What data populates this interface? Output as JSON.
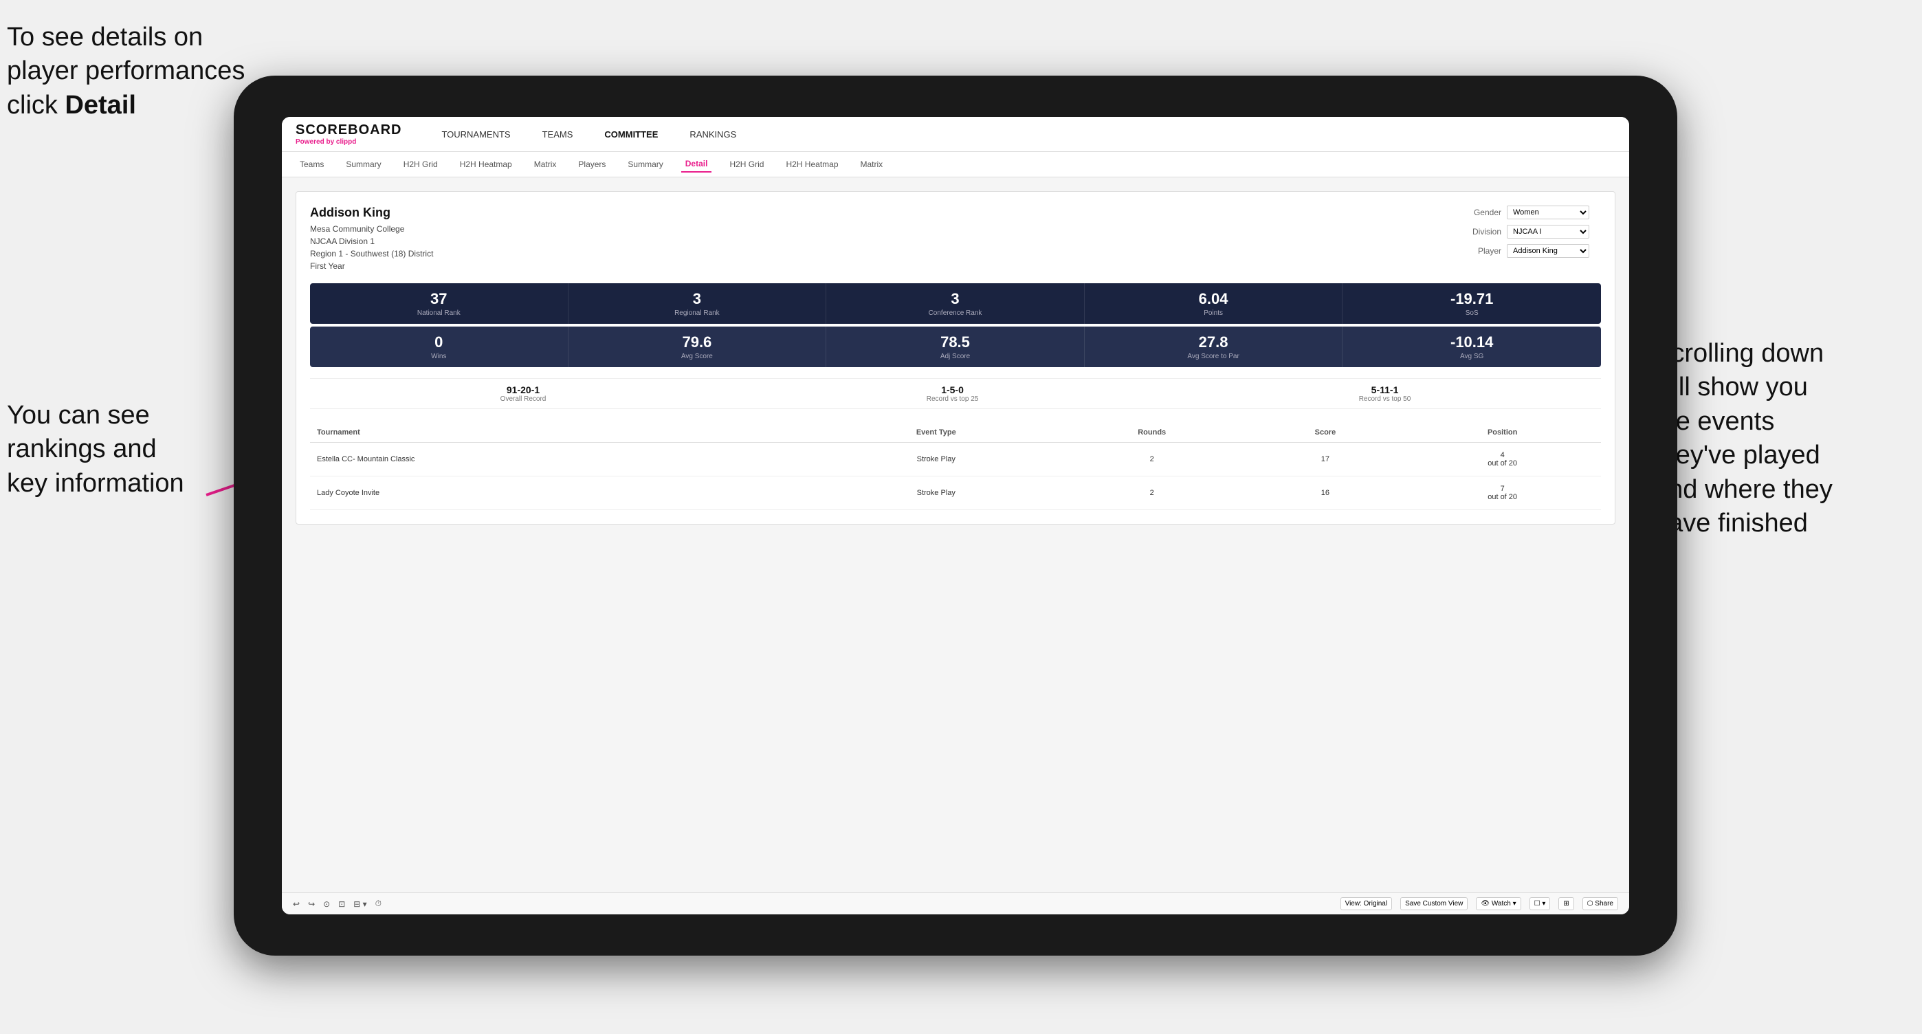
{
  "annotations": {
    "top_left_line1": "To see details on",
    "top_left_line2": "player performances",
    "top_left_line3_pre": "click ",
    "top_left_line3_bold": "Detail",
    "bottom_left_line1": "You can see",
    "bottom_left_line2": "rankings and",
    "bottom_left_line3": "key information",
    "right_line1": "Scrolling down",
    "right_line2": "will show you",
    "right_line3": "the events",
    "right_line4": "they've played",
    "right_line5": "and where they",
    "right_line6": "have finished"
  },
  "nav": {
    "logo": "SCOREBOARD",
    "powered_by": "Powered by ",
    "brand": "clippd",
    "items": [
      "TOURNAMENTS",
      "TEAMS",
      "COMMITTEE",
      "RANKINGS"
    ]
  },
  "sub_nav": {
    "items": [
      "Teams",
      "Summary",
      "H2H Grid",
      "H2H Heatmap",
      "Matrix",
      "Players",
      "Summary",
      "Detail",
      "H2H Grid",
      "H2H Heatmap",
      "Matrix"
    ],
    "active": "Detail"
  },
  "player": {
    "name": "Addison King",
    "college": "Mesa Community College",
    "division": "NJCAA Division 1",
    "region": "Region 1 - Southwest (18) District",
    "year": "First Year"
  },
  "controls": {
    "gender_label": "Gender",
    "gender_value": "Women",
    "division_label": "Division",
    "division_value": "NJCAA I",
    "player_label": "Player",
    "player_value": "Addison King"
  },
  "stats_row1": [
    {
      "value": "37",
      "label": "National Rank"
    },
    {
      "value": "3",
      "label": "Regional Rank"
    },
    {
      "value": "3",
      "label": "Conference Rank"
    },
    {
      "value": "6.04",
      "label": "Points"
    },
    {
      "value": "-19.71",
      "label": "SoS"
    }
  ],
  "stats_row2": [
    {
      "value": "0",
      "label": "Wins"
    },
    {
      "value": "79.6",
      "label": "Avg Score"
    },
    {
      "value": "78.5",
      "label": "Adj Score"
    },
    {
      "value": "27.8",
      "label": "Avg Score to Par"
    },
    {
      "value": "-10.14",
      "label": "Avg SG"
    }
  ],
  "records": [
    {
      "value": "91-20-1",
      "label": "Overall Record"
    },
    {
      "value": "1-5-0",
      "label": "Record vs top 25"
    },
    {
      "value": "5-11-1",
      "label": "Record vs top 50"
    }
  ],
  "table": {
    "headers": [
      "Tournament",
      "Event Type",
      "Rounds",
      "Score",
      "Position"
    ],
    "rows": [
      {
        "tournament": "Estella CC- Mountain Classic",
        "event_type": "Stroke Play",
        "rounds": "2",
        "score": "17",
        "position": "4\nout of 20"
      },
      {
        "tournament": "Lady Coyote Invite",
        "event_type": "Stroke Play",
        "rounds": "2",
        "score": "16",
        "position": "7\nout of 20"
      }
    ]
  },
  "toolbar": {
    "items": [
      "↩",
      "↪",
      "⊙",
      "⊡",
      "⊟ ▾",
      "⏱",
      "View: Original",
      "Save Custom View",
      "👁 Watch ▾",
      "☐ ▾",
      "⊞",
      "Share"
    ]
  }
}
